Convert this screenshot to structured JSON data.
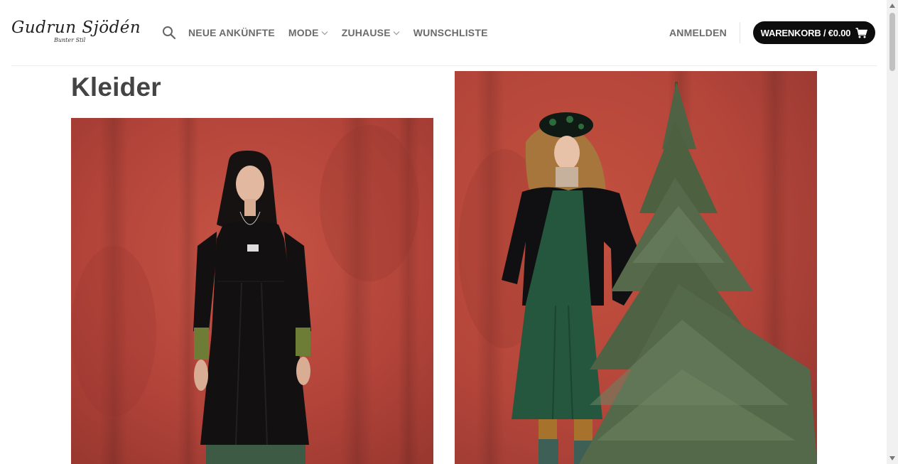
{
  "brand": {
    "name": "Gudrun Sjödén",
    "tagline": "Bunter Stil"
  },
  "nav": {
    "items": [
      {
        "label": "NEUE ANKÜNFTE",
        "has_dropdown": false
      },
      {
        "label": "MODE",
        "has_dropdown": true
      },
      {
        "label": "ZUHAUSE",
        "has_dropdown": true
      },
      {
        "label": "WUNSCHLISTE",
        "has_dropdown": false
      }
    ],
    "login_label": "ANMELDEN",
    "cart_label": "WARENKORB / €0.00"
  },
  "page": {
    "title": "Kleider"
  },
  "products": [
    {
      "image": "woman-black-corduroy-dress-red-backdrop"
    },
    {
      "image": "woman-green-corduroy-dress-christmas-tree-red-backdrop"
    }
  ],
  "colors": {
    "cart_button": "#0d0d0d",
    "nav_text": "#6b6b6b",
    "backdrop_red": "#b9473b"
  }
}
